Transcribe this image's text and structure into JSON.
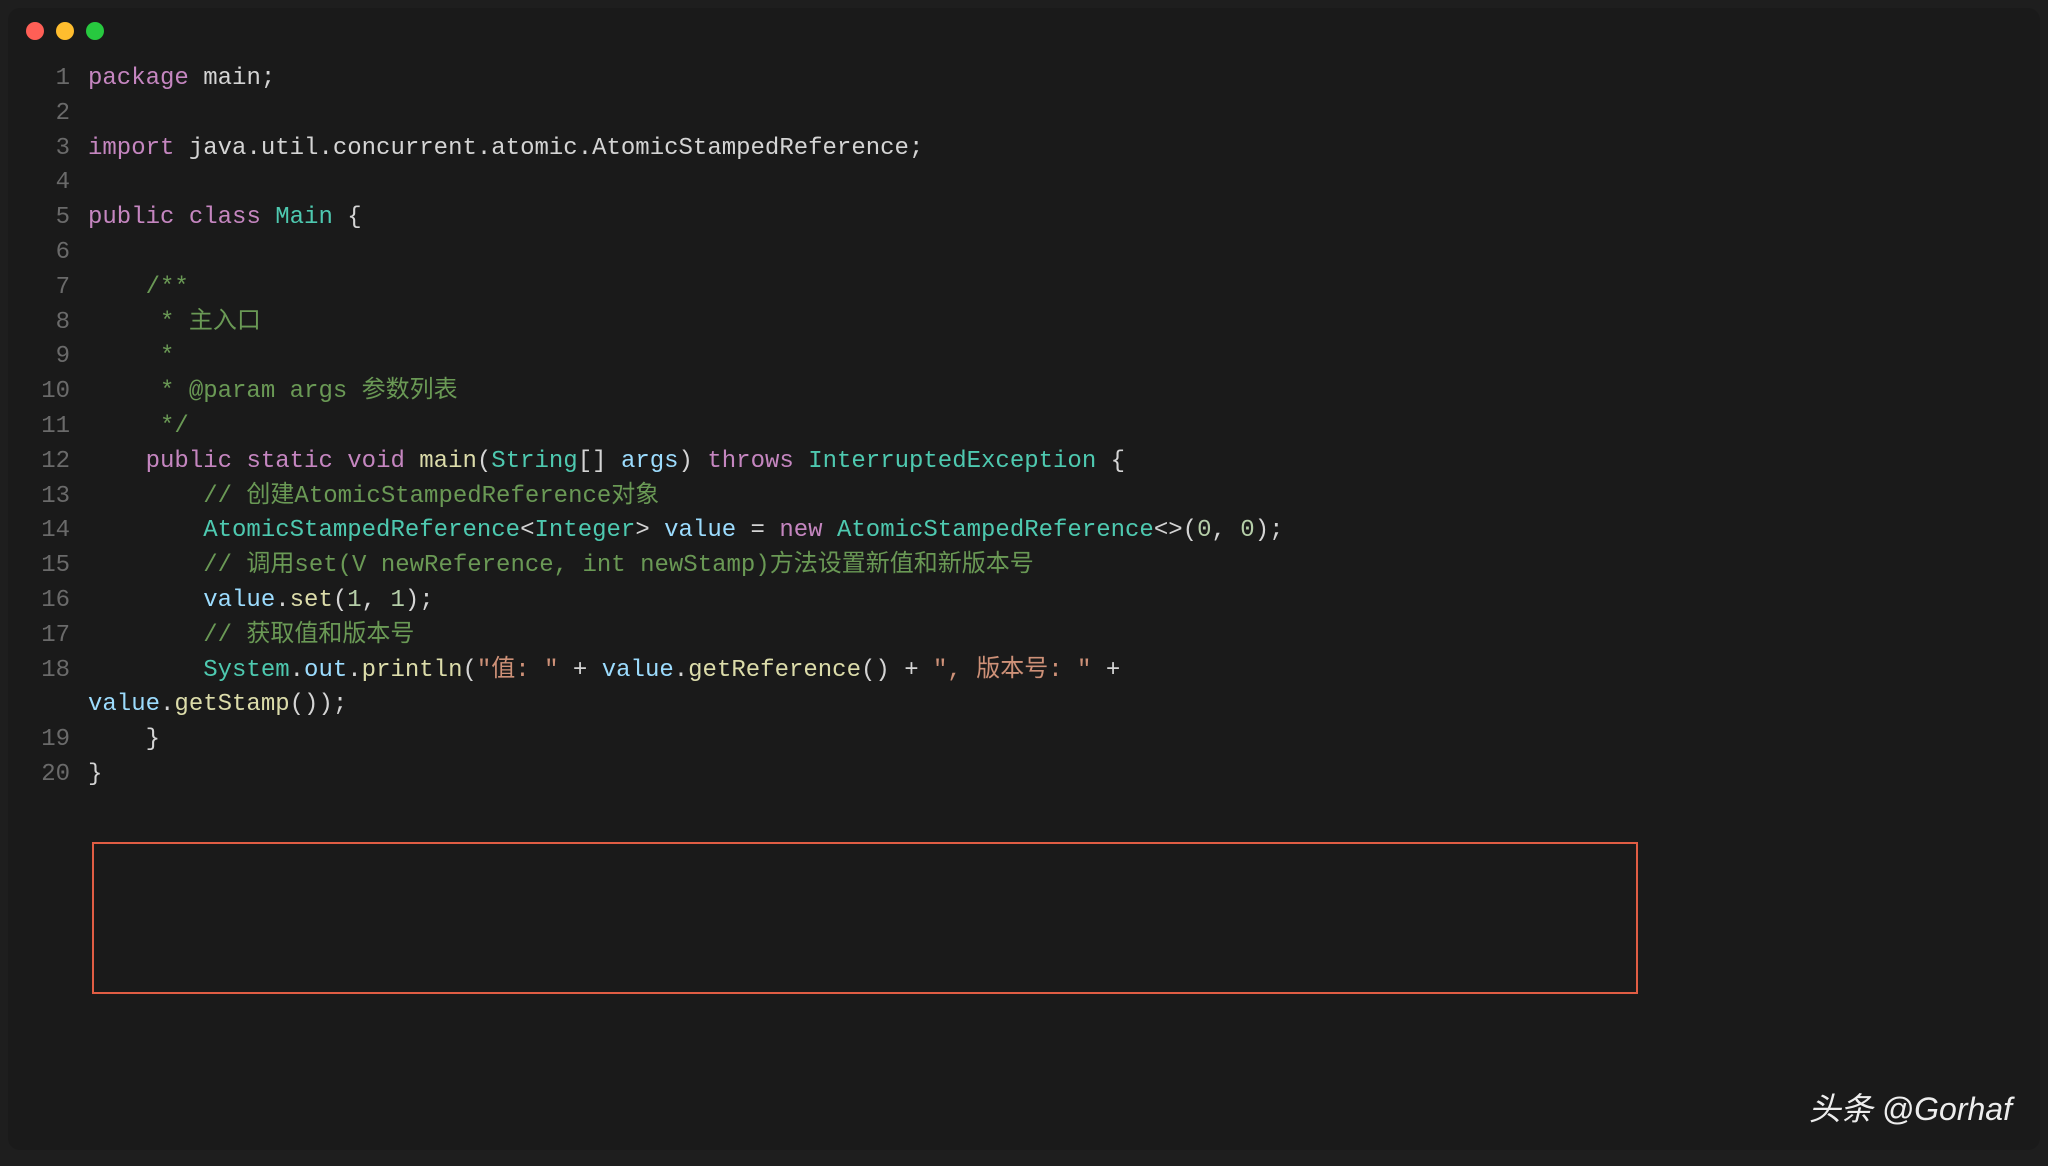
{
  "window": {
    "traffic_lights": [
      "close",
      "minimize",
      "maximize"
    ]
  },
  "code": {
    "lines": [
      {
        "n": "1",
        "segs": [
          {
            "c": "kw",
            "t": "package"
          },
          {
            "c": "pun",
            "t": " "
          },
          {
            "c": "pkg",
            "t": "main"
          },
          {
            "c": "pun",
            "t": ";"
          }
        ]
      },
      {
        "n": "2",
        "segs": []
      },
      {
        "n": "3",
        "segs": [
          {
            "c": "kw",
            "t": "import"
          },
          {
            "c": "pun",
            "t": " "
          },
          {
            "c": "pkg",
            "t": "java.util.concurrent.atomic.AtomicStampedReference"
          },
          {
            "c": "pun",
            "t": ";"
          }
        ]
      },
      {
        "n": "4",
        "segs": []
      },
      {
        "n": "5",
        "segs": [
          {
            "c": "kw",
            "t": "public"
          },
          {
            "c": "pun",
            "t": " "
          },
          {
            "c": "kw",
            "t": "class"
          },
          {
            "c": "pun",
            "t": " "
          },
          {
            "c": "cls",
            "t": "Main"
          },
          {
            "c": "pun",
            "t": " {"
          }
        ]
      },
      {
        "n": "6",
        "segs": []
      },
      {
        "n": "7",
        "segs": [
          {
            "c": "pun",
            "t": "    "
          },
          {
            "c": "doc",
            "t": "/**"
          }
        ]
      },
      {
        "n": "8",
        "segs": [
          {
            "c": "pun",
            "t": "    "
          },
          {
            "c": "doc",
            "t": " * 主入口"
          }
        ]
      },
      {
        "n": "9",
        "segs": [
          {
            "c": "pun",
            "t": "    "
          },
          {
            "c": "doc",
            "t": " *"
          }
        ]
      },
      {
        "n": "10",
        "segs": [
          {
            "c": "pun",
            "t": "    "
          },
          {
            "c": "doc",
            "t": " * @param args 参数列表"
          }
        ]
      },
      {
        "n": "11",
        "segs": [
          {
            "c": "pun",
            "t": "    "
          },
          {
            "c": "doc",
            "t": " */"
          }
        ]
      },
      {
        "n": "12",
        "segs": [
          {
            "c": "pun",
            "t": "    "
          },
          {
            "c": "kw",
            "t": "public"
          },
          {
            "c": "pun",
            "t": " "
          },
          {
            "c": "kw",
            "t": "static"
          },
          {
            "c": "pun",
            "t": " "
          },
          {
            "c": "kw",
            "t": "void"
          },
          {
            "c": "pun",
            "t": " "
          },
          {
            "c": "mtd",
            "t": "main"
          },
          {
            "c": "pun",
            "t": "("
          },
          {
            "c": "typ",
            "t": "String"
          },
          {
            "c": "pun",
            "t": "[] "
          },
          {
            "c": "id",
            "t": "args"
          },
          {
            "c": "pun",
            "t": ") "
          },
          {
            "c": "kw",
            "t": "throws"
          },
          {
            "c": "pun",
            "t": " "
          },
          {
            "c": "typ",
            "t": "InterruptedException"
          },
          {
            "c": "pun",
            "t": " {"
          }
        ]
      },
      {
        "n": "13",
        "segs": [
          {
            "c": "pun",
            "t": "        "
          },
          {
            "c": "com",
            "t": "// 创建AtomicStampedReference对象"
          }
        ]
      },
      {
        "n": "14",
        "segs": [
          {
            "c": "pun",
            "t": "        "
          },
          {
            "c": "typ",
            "t": "AtomicStampedReference"
          },
          {
            "c": "pun",
            "t": "<"
          },
          {
            "c": "typ",
            "t": "Integer"
          },
          {
            "c": "pun",
            "t": "> "
          },
          {
            "c": "id",
            "t": "value"
          },
          {
            "c": "pun",
            "t": " = "
          },
          {
            "c": "kw",
            "t": "new"
          },
          {
            "c": "pun",
            "t": " "
          },
          {
            "c": "typ",
            "t": "AtomicStampedReference"
          },
          {
            "c": "pun",
            "t": "<>("
          },
          {
            "c": "num",
            "t": "0"
          },
          {
            "c": "pun",
            "t": ", "
          },
          {
            "c": "num",
            "t": "0"
          },
          {
            "c": "pun",
            "t": ");"
          }
        ]
      },
      {
        "n": "15",
        "segs": [
          {
            "c": "pun",
            "t": "        "
          },
          {
            "c": "com",
            "t": "// 调用set(V newReference, int newStamp)方法设置新值和新版本号"
          }
        ]
      },
      {
        "n": "16",
        "segs": [
          {
            "c": "pun",
            "t": "        "
          },
          {
            "c": "id",
            "t": "value"
          },
          {
            "c": "pun",
            "t": "."
          },
          {
            "c": "mtd",
            "t": "set"
          },
          {
            "c": "pun",
            "t": "("
          },
          {
            "c": "num",
            "t": "1"
          },
          {
            "c": "pun",
            "t": ", "
          },
          {
            "c": "num",
            "t": "1"
          },
          {
            "c": "pun",
            "t": ");"
          }
        ]
      },
      {
        "n": "17",
        "segs": [
          {
            "c": "pun",
            "t": "        "
          },
          {
            "c": "com",
            "t": "// 获取值和版本号"
          }
        ]
      },
      {
        "n": "18",
        "segs": [
          {
            "c": "pun",
            "t": "        "
          },
          {
            "c": "typ",
            "t": "System"
          },
          {
            "c": "pun",
            "t": "."
          },
          {
            "c": "id",
            "t": "out"
          },
          {
            "c": "pun",
            "t": "."
          },
          {
            "c": "mtd",
            "t": "println"
          },
          {
            "c": "pun",
            "t": "("
          },
          {
            "c": "str",
            "t": "\"值: \""
          },
          {
            "c": "pun",
            "t": " + "
          },
          {
            "c": "id",
            "t": "value"
          },
          {
            "c": "pun",
            "t": "."
          },
          {
            "c": "mtd",
            "t": "getReference"
          },
          {
            "c": "pun",
            "t": "() + "
          },
          {
            "c": "str",
            "t": "\", 版本号: \""
          },
          {
            "c": "pun",
            "t": " + "
          }
        ]
      },
      {
        "n": "",
        "segs": [
          {
            "c": "id",
            "t": "value"
          },
          {
            "c": "pun",
            "t": "."
          },
          {
            "c": "mtd",
            "t": "getStamp"
          },
          {
            "c": "pun",
            "t": "());"
          }
        ]
      },
      {
        "n": "19",
        "segs": [
          {
            "c": "pun",
            "t": "    }"
          }
        ]
      },
      {
        "n": "20",
        "segs": [
          {
            "c": "pun",
            "t": "}"
          }
        ]
      }
    ]
  },
  "watermark": "头条 @Gorhaf"
}
